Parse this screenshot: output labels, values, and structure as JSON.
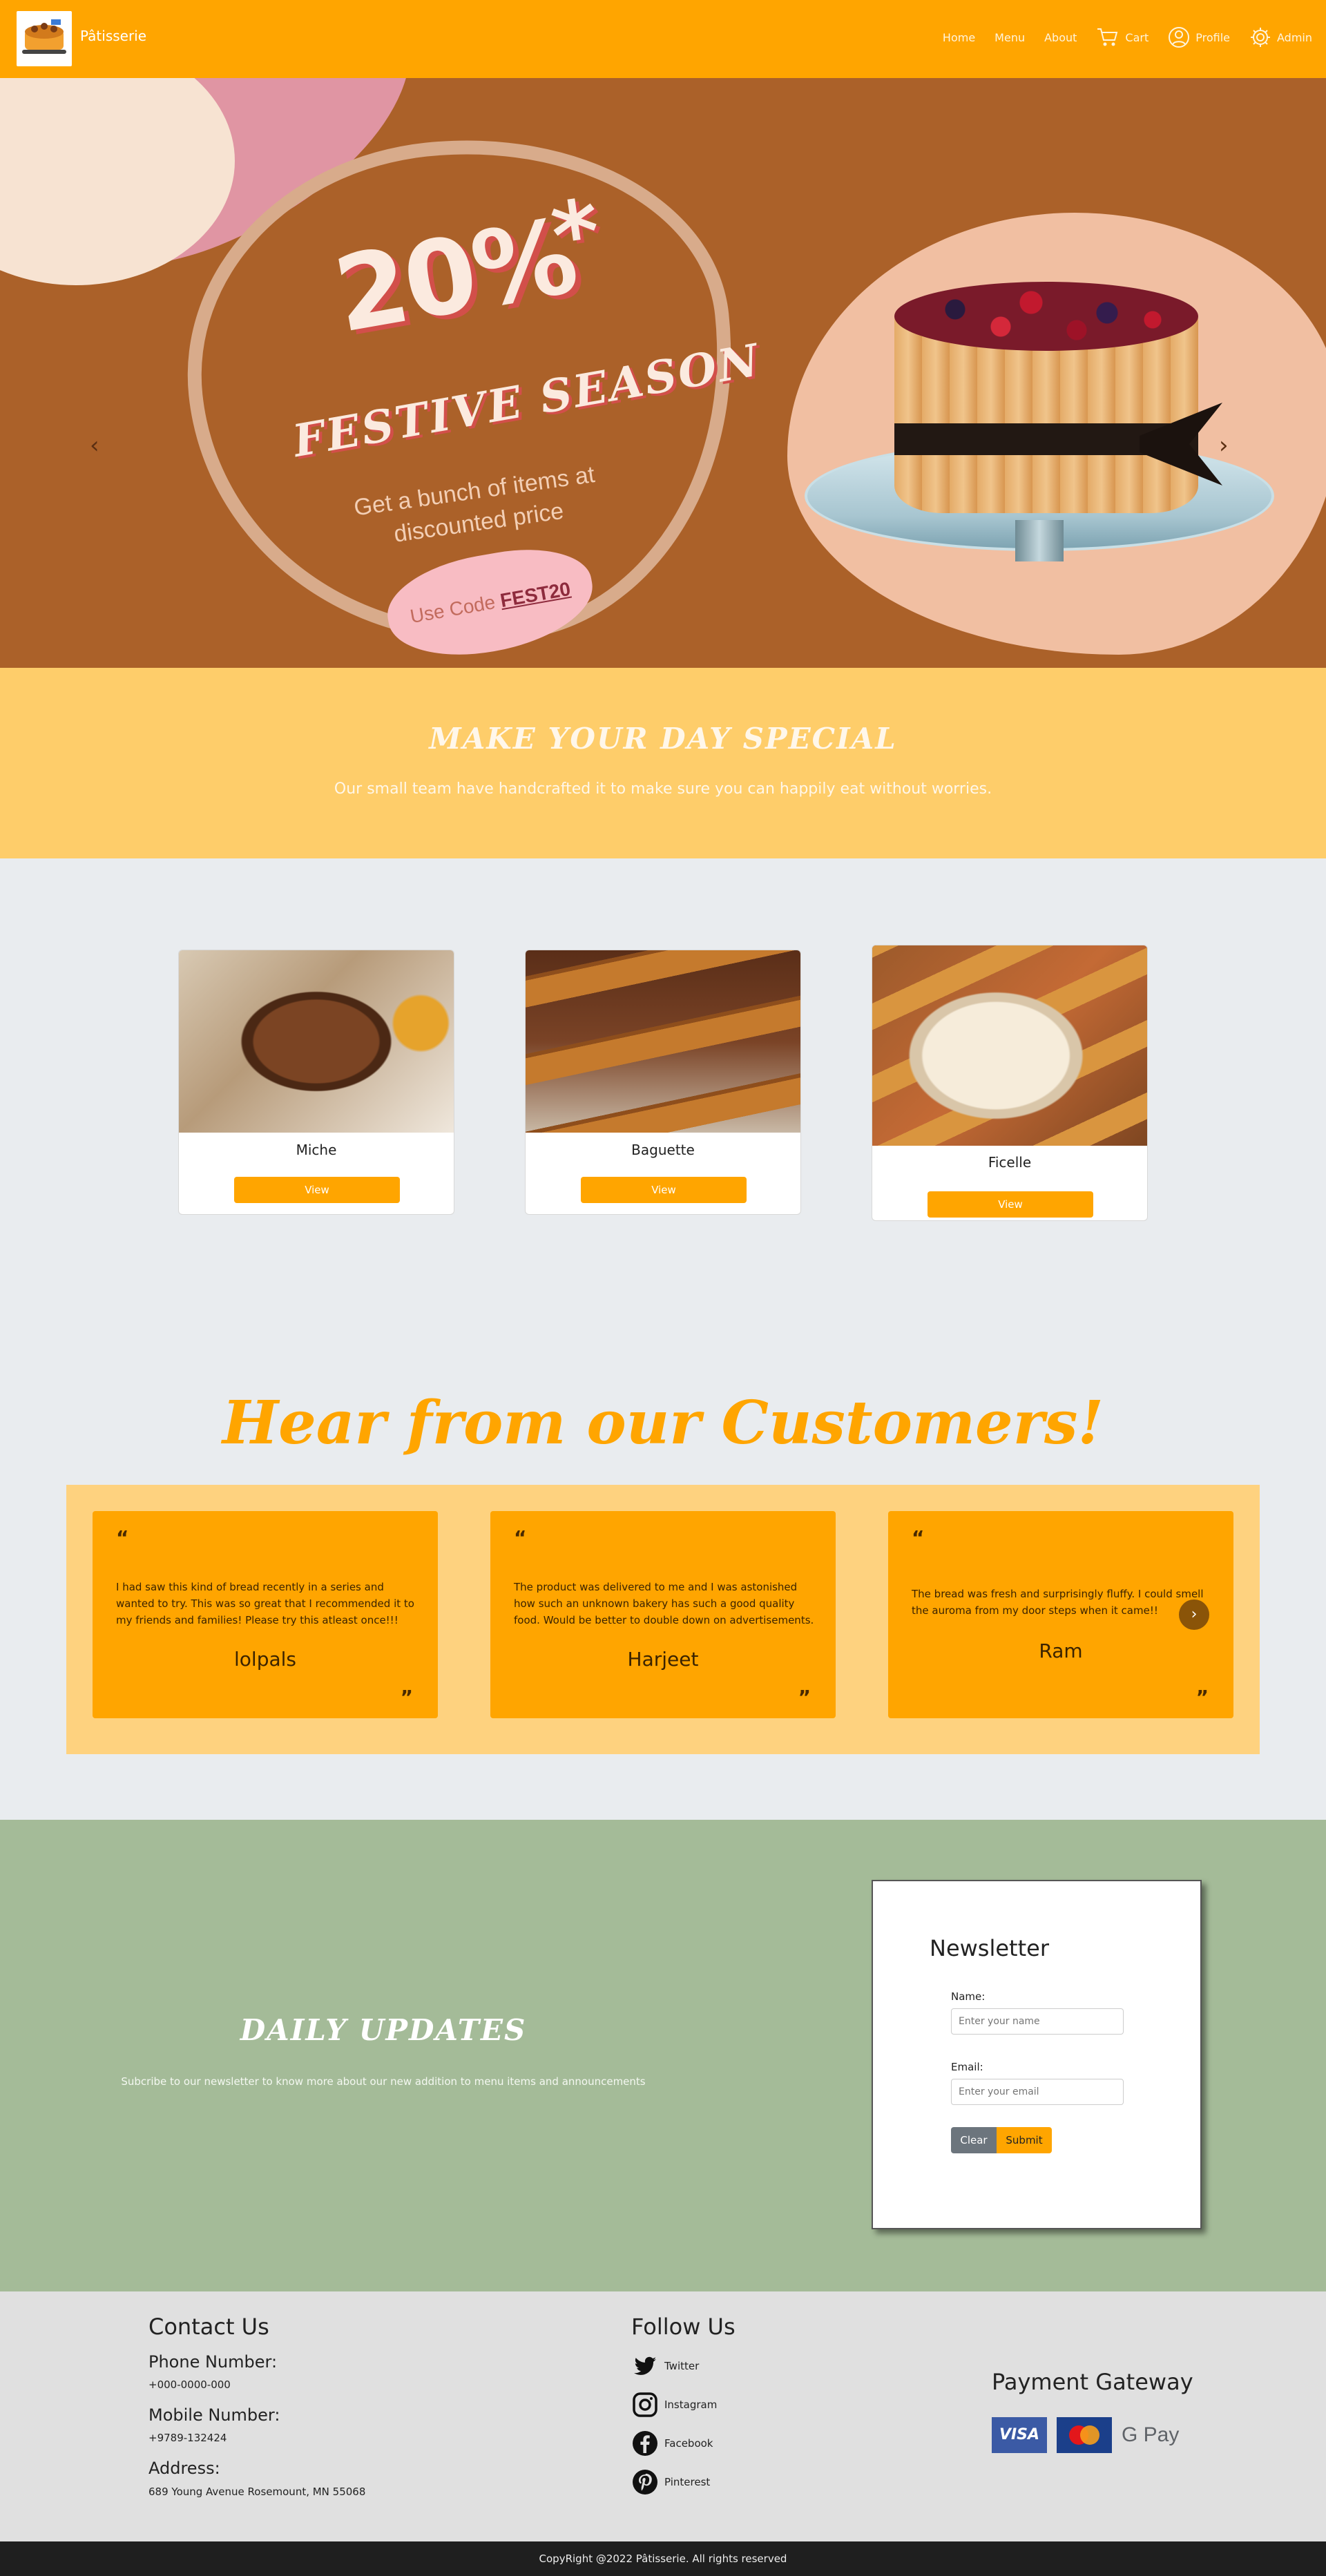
{
  "navbar": {
    "brand": "Pâtisserie",
    "links": [
      {
        "label": "Home",
        "icon": null
      },
      {
        "label": "Menu",
        "icon": null
      },
      {
        "label": "About",
        "icon": null
      },
      {
        "label": "Cart",
        "icon": "cart-icon"
      },
      {
        "label": "Profile",
        "icon": "user-circle-icon"
      },
      {
        "label": "Admin",
        "icon": "gear-icon"
      }
    ],
    "color": "#ffa500"
  },
  "hero": {
    "percent": "20%",
    "star": "*",
    "title": "FESTIVE SEASON",
    "subtitle": "Get a bunch of items at discounted price",
    "code_prefix": "Use Code",
    "code": "FEST20",
    "slides": 3,
    "active_slide": 2
  },
  "special": {
    "title": "MAKE YOUR DAY SPECIAL",
    "subtitle": "Our small team have handcrafted it to make sure you can happily eat without worries."
  },
  "products": [
    {
      "name": "Miche",
      "button": "View"
    },
    {
      "name": "Baguette",
      "button": "View"
    },
    {
      "name": "Ficelle",
      "button": "View"
    }
  ],
  "testimonials": {
    "heading": "Hear from our Customers!",
    "items": [
      {
        "text": "I had saw this kind of bread recently in a series and wanted to try. This was so great that I recommended it to my friends and families! Please try this atleast once!!!",
        "name": "lolpals"
      },
      {
        "text": "The product was delivered to me and I was astonished how such an unknown bakery has such a good quality food. Would be better to double down on advertisements.",
        "name": "Harjeet"
      },
      {
        "text": "The bread was fresh and surprisingly fluffy. I could smell the auroma from my door steps when it came!!",
        "name": "Ram"
      }
    ],
    "open_quote": "“",
    "close_quote": "”"
  },
  "updates": {
    "title": "DAILY UPDATES",
    "subtitle": "Subcribe to our newsletter to know more about our new addition to menu items and announcements"
  },
  "newsletter": {
    "title": "Newsletter",
    "name_label": "Name:",
    "name_placeholder": "Enter your name",
    "email_label": "Email:",
    "email_placeholder": "Enter your email",
    "clear": "Clear",
    "submit": "Submit"
  },
  "footer": {
    "contact_title": "Contact Us",
    "phone_label": "Phone Number:",
    "phone": "+000-0000-000",
    "mobile_label": "Mobile Number:",
    "mobile": "+9789-132424",
    "address_label": "Address:",
    "address": "689 Young Avenue Rosemount, MN 55068",
    "follow_title": "Follow Us",
    "socials": [
      {
        "label": "Twitter",
        "icon": "twitter-icon"
      },
      {
        "label": "Instagram",
        "icon": "instagram-icon"
      },
      {
        "label": "Facebook",
        "icon": "facebook-icon"
      },
      {
        "label": "Pinterest",
        "icon": "pinterest-icon"
      }
    ],
    "payment_title": "Payment Gateway",
    "payments": [
      "VISA",
      "MasterCard",
      "G Pay"
    ],
    "copyright": "CopyRight @2022 Pâtisserie. All rights reserved"
  }
}
